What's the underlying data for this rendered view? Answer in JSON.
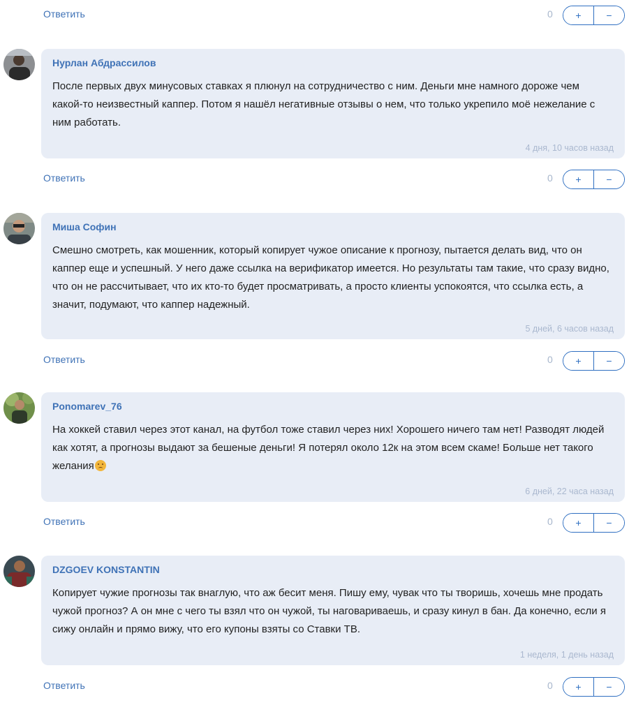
{
  "reply_label": "Ответить",
  "vote": {
    "score": "0",
    "plus": "+",
    "minus": "−"
  },
  "comments": [
    {
      "author": "Нурлан Абдрассилов",
      "text": "После первых двух минусовых ставках я плюнул на сотрудничество с ним. Деньги мне намного дороже чем какой-то неизвестный каппер. Потом я нашёл негативные отзывы о нем, что только укрепило моё нежелание с ним работать.",
      "time": "4 дня, 10 часов назад"
    },
    {
      "author": "Миша Софин",
      "text": "Смешно смотреть, как мошенник, который копирует чужое описание к прогнозу, пытается делать вид, что он каппер еще и успешный. У него даже ссылка на верификатор имеется. Но результаты там такие, что сразу видно, что он не рассчитывает, что их кто-то будет просматривать, а просто клиенты успокоятся, что ссылка есть, а значит, подумают, что каппер надежный.",
      "time": "5 дней, 6 часов назад"
    },
    {
      "author": "Ponomarev_76",
      "text": "На хоккей ставил через этот канал, на футбол тоже ставил через них! Хорошего ничего там нет! Разводят людей как хотят, а прогнозы выдают за бешеные деньги! Я потерял около 12к на этом всем скаме! Больше нет такого желания",
      "emoji": "worried-face-icon",
      "time": "6 дней, 22 часа назад"
    },
    {
      "author": "DZGOEV KONSTANTIN",
      "text": "Копирует чужие прогнозы так внаглую, что аж бесит меня. Пишу ему, чувак что ты творишь, хочешь мне продать чужой прогноз? А он мне с чего ты взял что он чужой, ты наговариваешь, и сразу кинул в бан. Да конечно, если я сижу онлайн и прямо вижу, что его купоны взяты со Ставки ТВ.",
      "time": "1 неделя, 1 день назад"
    }
  ],
  "colors": {
    "link": "#3f72b6",
    "bubble": "#e8edf6",
    "vote_border": "#2f6fc1",
    "muted": "#aab8cf"
  }
}
